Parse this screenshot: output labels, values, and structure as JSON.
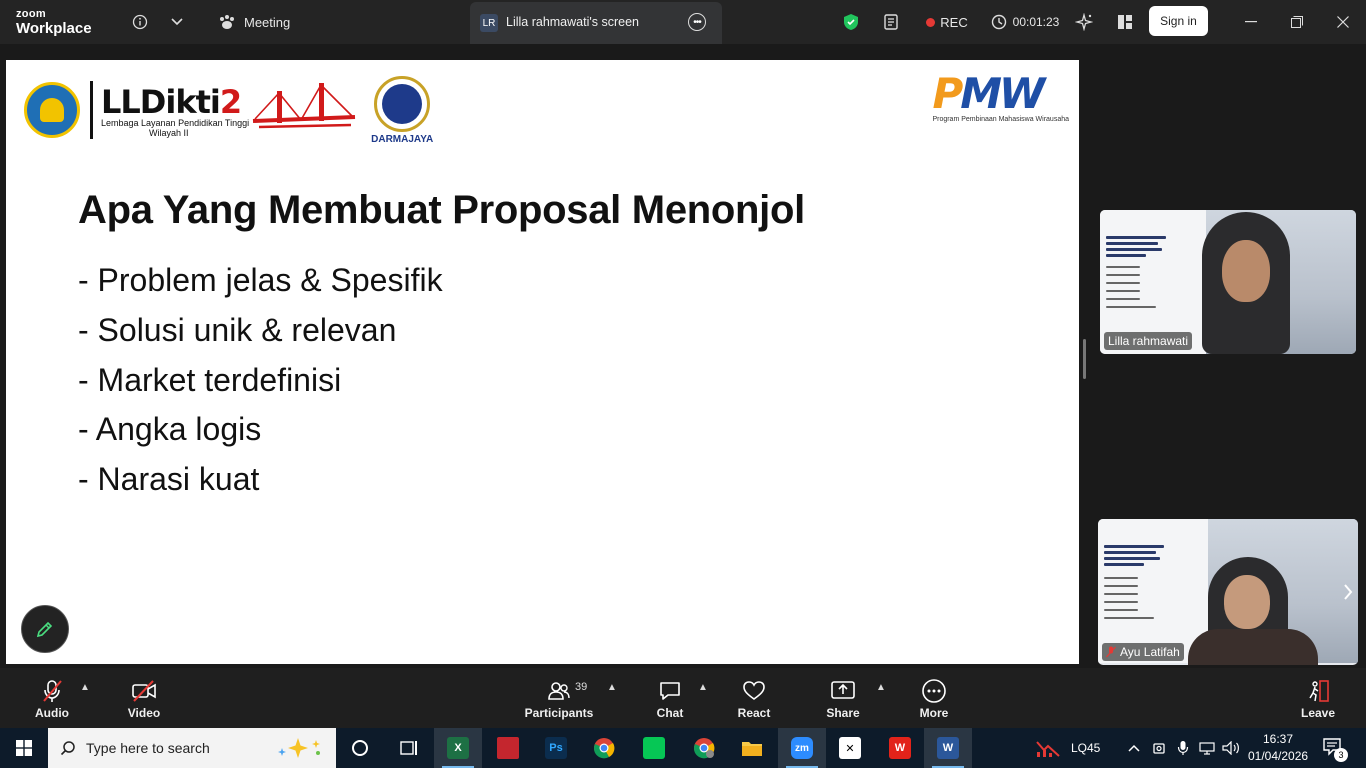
{
  "app": {
    "brand_line1": "zoom",
    "brand_line2": "Workplace",
    "meeting_label": "Meeting",
    "screen_badge": "LR",
    "screen_tab_label": "Lilla rahmawati's screen",
    "rec_label": "REC",
    "timer": "00:01:23",
    "signin_label": "Sign in",
    "colors": {
      "topbar": "#242424",
      "rec": "#e53935",
      "shield": "#21c55d"
    }
  },
  "slide": {
    "lldikti_name": "LLDikti",
    "lldikti_num": "2",
    "lldikti_sub1": "Lembaga Layanan Pendidikan Tinggi",
    "lldikti_sub2": "Wilayah II",
    "darmajaya_label": "DARMAJAYA",
    "pmw_p": "P",
    "pmw_mw": "MW",
    "pmw_tag": "Program Pembinaan Mahasiswa Wirausaha",
    "title": "Apa Yang Membuat Proposal Menonjol",
    "bullets": [
      "- Problem jelas & Spesifik",
      "- Solusi unik & relevan",
      "- Market terdefinisi",
      "- Angka logis",
      "- Narasi kuat"
    ]
  },
  "participants": [
    {
      "name": "Lilla rahmawati",
      "muted": false
    },
    {
      "name": "Ayu Latifah",
      "muted": true
    }
  ],
  "controls": {
    "audio_label": "Audio",
    "video_label": "Video",
    "participants_label": "Participants",
    "participants_count": "39",
    "chat_label": "Chat",
    "react_label": "React",
    "share_label": "Share",
    "more_label": "More",
    "leave_label": "Leave"
  },
  "taskbar": {
    "search_placeholder": "Type here to search",
    "tray_label": "LQ45",
    "time": "16:37",
    "date": "01/04/2026",
    "notification_count": "3",
    "apps": [
      "task-view",
      "excel",
      "snipping-tool",
      "photoshop",
      "chrome",
      "line",
      "chrome-profile",
      "file-explorer",
      "zoom",
      "capcut",
      "wps",
      "word"
    ]
  }
}
